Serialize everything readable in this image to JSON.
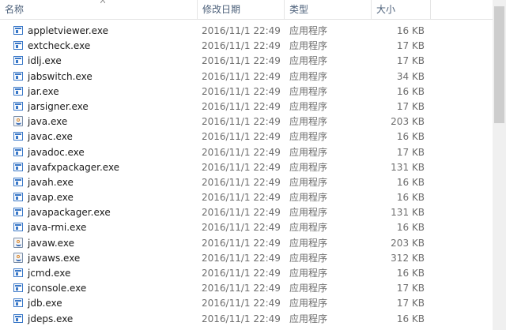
{
  "columns": {
    "name": "名称",
    "date": "修改日期",
    "type": "类型",
    "size": "大小"
  },
  "files": [
    {
      "name": "appletviewer.exe",
      "date": "2016/11/1 22:49",
      "type": "应用程序",
      "size": "16 KB",
      "icon": "app-icon"
    },
    {
      "name": "extcheck.exe",
      "date": "2016/11/1 22:49",
      "type": "应用程序",
      "size": "17 KB",
      "icon": "app-icon"
    },
    {
      "name": "idlj.exe",
      "date": "2016/11/1 22:49",
      "type": "应用程序",
      "size": "17 KB",
      "icon": "app-icon"
    },
    {
      "name": "jabswitch.exe",
      "date": "2016/11/1 22:49",
      "type": "应用程序",
      "size": "34 KB",
      "icon": "app-icon"
    },
    {
      "name": "jar.exe",
      "date": "2016/11/1 22:49",
      "type": "应用程序",
      "size": "16 KB",
      "icon": "app-icon"
    },
    {
      "name": "jarsigner.exe",
      "date": "2016/11/1 22:49",
      "type": "应用程序",
      "size": "17 KB",
      "icon": "app-icon"
    },
    {
      "name": "java.exe",
      "date": "2016/11/1 22:49",
      "type": "应用程序",
      "size": "203 KB",
      "icon": "java-icon"
    },
    {
      "name": "javac.exe",
      "date": "2016/11/1 22:49",
      "type": "应用程序",
      "size": "16 KB",
      "icon": "app-icon"
    },
    {
      "name": "javadoc.exe",
      "date": "2016/11/1 22:49",
      "type": "应用程序",
      "size": "17 KB",
      "icon": "app-icon"
    },
    {
      "name": "javafxpackager.exe",
      "date": "2016/11/1 22:49",
      "type": "应用程序",
      "size": "131 KB",
      "icon": "app-icon"
    },
    {
      "name": "javah.exe",
      "date": "2016/11/1 22:49",
      "type": "应用程序",
      "size": "16 KB",
      "icon": "app-icon"
    },
    {
      "name": "javap.exe",
      "date": "2016/11/1 22:49",
      "type": "应用程序",
      "size": "16 KB",
      "icon": "app-icon"
    },
    {
      "name": "javapackager.exe",
      "date": "2016/11/1 22:49",
      "type": "应用程序",
      "size": "131 KB",
      "icon": "app-icon"
    },
    {
      "name": "java-rmi.exe",
      "date": "2016/11/1 22:49",
      "type": "应用程序",
      "size": "16 KB",
      "icon": "app-icon"
    },
    {
      "name": "javaw.exe",
      "date": "2016/11/1 22:49",
      "type": "应用程序",
      "size": "203 KB",
      "icon": "java-icon"
    },
    {
      "name": "javaws.exe",
      "date": "2016/11/1 22:49",
      "type": "应用程序",
      "size": "312 KB",
      "icon": "java-icon"
    },
    {
      "name": "jcmd.exe",
      "date": "2016/11/1 22:49",
      "type": "应用程序",
      "size": "16 KB",
      "icon": "app-icon"
    },
    {
      "name": "jconsole.exe",
      "date": "2016/11/1 22:49",
      "type": "应用程序",
      "size": "17 KB",
      "icon": "app-icon"
    },
    {
      "name": "jdb.exe",
      "date": "2016/11/1 22:49",
      "type": "应用程序",
      "size": "17 KB",
      "icon": "app-icon"
    },
    {
      "name": "jdeps.exe",
      "date": "2016/11/1 22:49",
      "type": "应用程序",
      "size": "16 KB",
      "icon": "app-icon"
    }
  ]
}
